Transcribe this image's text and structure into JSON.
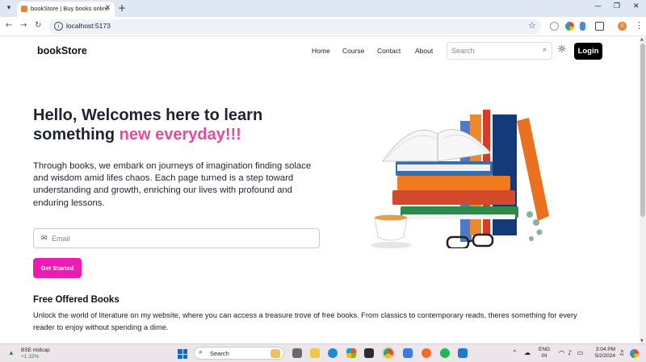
{
  "browser": {
    "tab_title": "bookStore | Buy books online",
    "new_tab": "+",
    "url": "localhost:5173",
    "profile_initial": "S"
  },
  "nav": {
    "brand": "bookStore",
    "links": [
      "Home",
      "Course",
      "Contact",
      "About"
    ],
    "search_placeholder": "Search",
    "login": "Login"
  },
  "hero": {
    "title_line1": "Hello, Welcomes here to learn",
    "title_line2_plain": "something ",
    "title_line2_accent": "new everyday!!!",
    "paragraph": "Through books, we embark on journeys of imagination finding solace and wisdom amid lifes chaos. Each page turned is a step toward understanding and growth, enriching our lives with profound and enduring lessons.",
    "email_placeholder": "Email",
    "cta": "Get Started"
  },
  "free_section": {
    "title": "Free Offered Books",
    "text": "Unlock the world of literature on my website, where you can access a treasure trove of free books. From classics to contemporary reads, theres something for every reader to enjoy without spending a dime."
  },
  "taskbar": {
    "widget_name": "BSE midcap",
    "widget_change": "+1.32%",
    "search_label": "Search",
    "lang_line1": "ENG",
    "lang_line2": "IN",
    "time": "3:04 PM",
    "date": "5/2/2024"
  },
  "colors": {
    "accent_pink": "#ec4899",
    "cta_pink": "#ec1cb1"
  }
}
